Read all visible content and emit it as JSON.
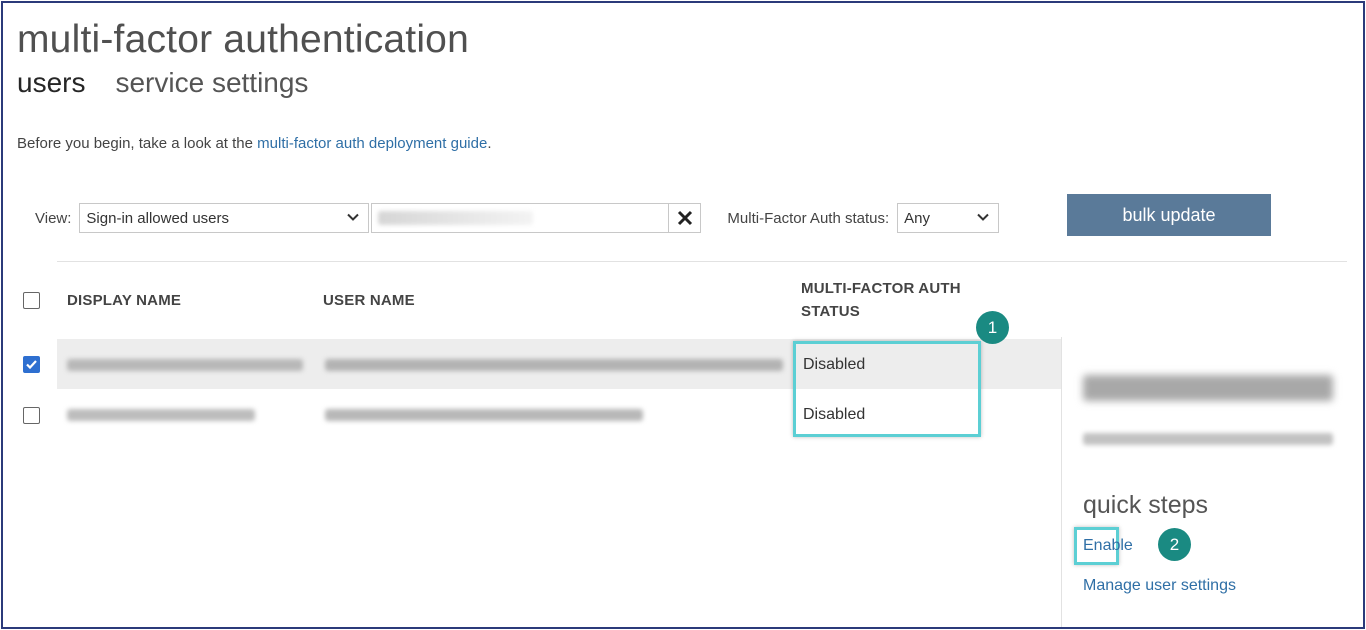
{
  "header": {
    "title": "multi-factor authentication",
    "tabs": [
      {
        "label": "users",
        "active": true
      },
      {
        "label": "service settings",
        "active": false
      }
    ]
  },
  "intro": {
    "prefix": "Before you begin, take a look at the ",
    "link": "multi-factor auth deployment guide",
    "suffix": "."
  },
  "filters": {
    "view_label": "View:",
    "view_value": "Sign-in allowed users",
    "mfa_label": "Multi-Factor Auth status:",
    "mfa_value": "Any",
    "bulk_update": "bulk update"
  },
  "table": {
    "columns": {
      "display_name": "DISPLAY NAME",
      "user_name": "USER NAME",
      "mfa_status": "MULTI-FACTOR AUTH STATUS"
    },
    "rows": [
      {
        "checked": true,
        "status": "Disabled"
      },
      {
        "checked": false,
        "status": "Disabled"
      }
    ]
  },
  "side_panel": {
    "quick_steps": "quick steps",
    "enable": "Enable",
    "manage": "Manage user settings"
  },
  "callouts": [
    "1",
    "2"
  ],
  "colors": {
    "accent_link": "#2f6fa6",
    "bulk_button": "#5a7a99",
    "callout_border": "#5ccfd4",
    "badge": "#1a8a82",
    "checkbox_checked": "#2e6fd0"
  }
}
